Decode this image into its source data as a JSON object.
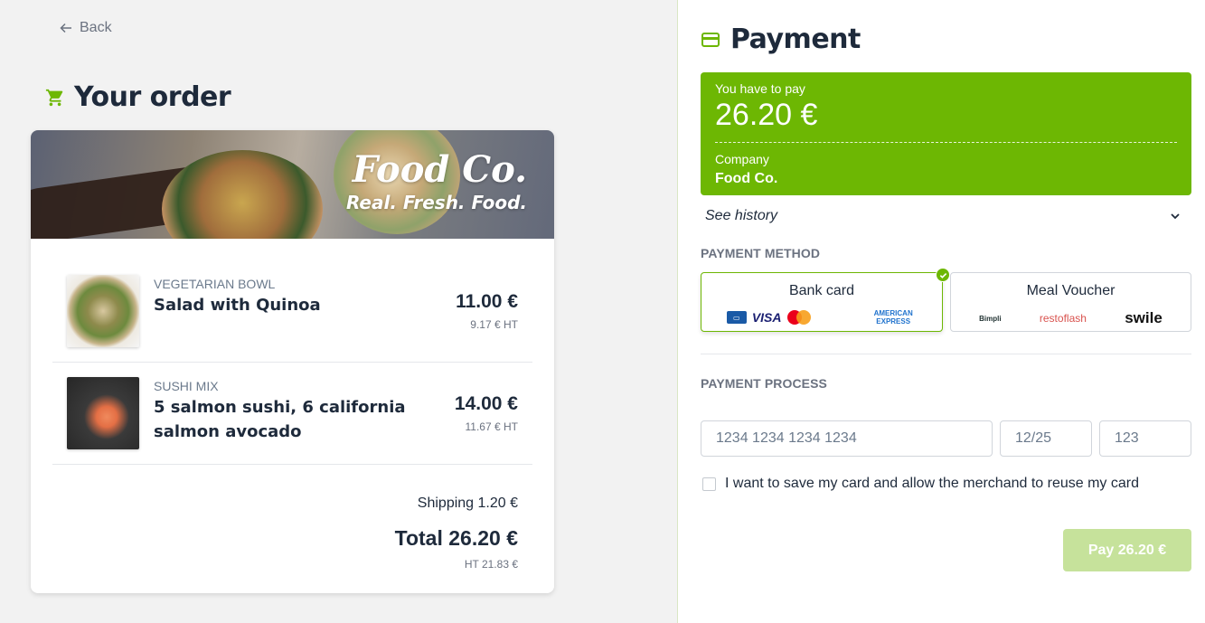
{
  "nav": {
    "back_label": "Back"
  },
  "order": {
    "title": "Your order",
    "banner": {
      "brand": "Food Co.",
      "tagline": "Real. Fresh. Food."
    },
    "items": [
      {
        "category": "VEGETARIAN BOWL",
        "name": "Salad with Quinoa",
        "price": "11.00 €",
        "price_ht": "9.17 € HT"
      },
      {
        "category": "SUSHI MIX",
        "name": "5 salmon sushi, 6 california salmon avocado",
        "price": "14.00 €",
        "price_ht": "11.67 € HT"
      }
    ],
    "shipping": "Shipping 1.20 €",
    "total": "Total 26.20 €",
    "total_ht": "HT 21.83 €"
  },
  "payment": {
    "title": "Payment",
    "to_pay_label": "You have to pay",
    "amount": "26.20 €",
    "company_label": "Company",
    "company": "Food Co.",
    "history_label": "See history",
    "method_label": "PAYMENT METHOD",
    "methods": [
      {
        "label": "Bank card",
        "selected": true,
        "logos": [
          "cb-logo",
          "VISA",
          "mastercard-logo",
          "AMERICAN EXPRESS"
        ]
      },
      {
        "label": "Meal Voucher",
        "selected": false,
        "logos": [
          "Bimpli",
          "restoflash",
          "swile"
        ]
      }
    ],
    "process_label": "PAYMENT PROCESS",
    "card_number_placeholder": "1234 1234 1234 1234",
    "expiry_placeholder": "12/25",
    "cvc_placeholder": "123",
    "save_card_label": "I want to save my card and allow the merchand to reuse my card",
    "pay_button": "Pay 26.20 €"
  },
  "colors": {
    "accent": "#6db703",
    "pay_disabled": "#c6e29b",
    "text_dark": "#1e2a3b"
  }
}
